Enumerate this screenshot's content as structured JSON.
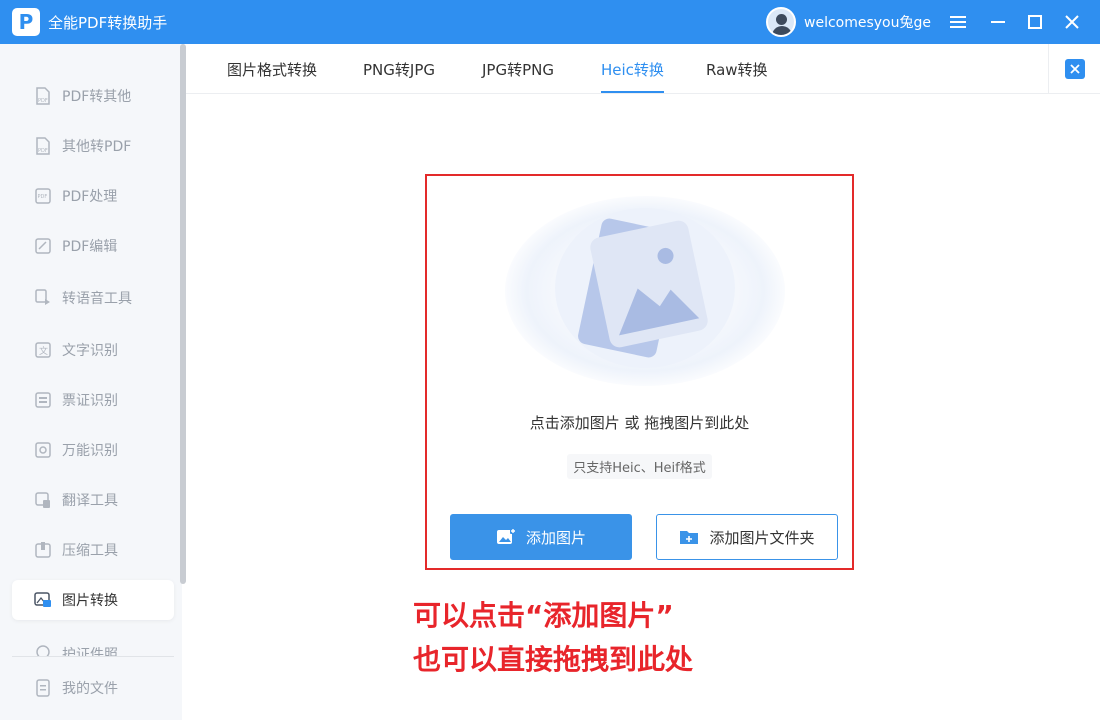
{
  "app": {
    "logo_letter": "P",
    "title": "全能PDF转换助手",
    "brand_color": "#2f8ff0",
    "user_name": "welcomesyou兔ge",
    "window_controls": [
      "menu-icon",
      "minimize-icon",
      "maximize-icon",
      "close-icon"
    ]
  },
  "sidebar": {
    "items": [
      {
        "label": "PDF转其他",
        "icon": "pdf-export-icon"
      },
      {
        "label": "其他转PDF",
        "icon": "pdf-import-icon"
      },
      {
        "label": "PDF处理",
        "icon": "pdf-process-icon"
      },
      {
        "label": "PDF编辑",
        "icon": "pdf-edit-icon"
      },
      {
        "label": "转语音工具",
        "icon": "speech-icon"
      },
      {
        "label": "文字识别",
        "icon": "text-ocr-icon"
      },
      {
        "label": "票证识别",
        "icon": "ticket-ocr-icon"
      },
      {
        "label": "万能识别",
        "icon": "universal-ocr-icon"
      },
      {
        "label": "翻译工具",
        "icon": "translate-icon"
      },
      {
        "label": "压缩工具",
        "icon": "compress-icon"
      },
      {
        "label": "图片转换",
        "icon": "image-convert-icon",
        "active": true
      },
      {
        "label": "护证件照",
        "icon": "id-photo-icon"
      }
    ],
    "bottom_item": {
      "label": "我的文件",
      "icon": "my-files-icon"
    }
  },
  "tabs": [
    {
      "label": "图片格式转换"
    },
    {
      "label": "PNG转JPG"
    },
    {
      "label": "JPG转PNG"
    },
    {
      "label": "Heic转换",
      "active": true
    },
    {
      "label": "Raw转换"
    }
  ],
  "dropzone": {
    "main_text": "点击添加图片 或 拖拽图片到此处",
    "sub_text": "只支持Heic、Heif格式",
    "add_button": "添加图片",
    "add_folder_button": "添加图片文件夹",
    "border_color": "#e32a2a"
  },
  "annotation": {
    "line1": "可以点击“添加图片”",
    "line2": "也可以直接拖拽到此处",
    "color": "#e8252b"
  }
}
